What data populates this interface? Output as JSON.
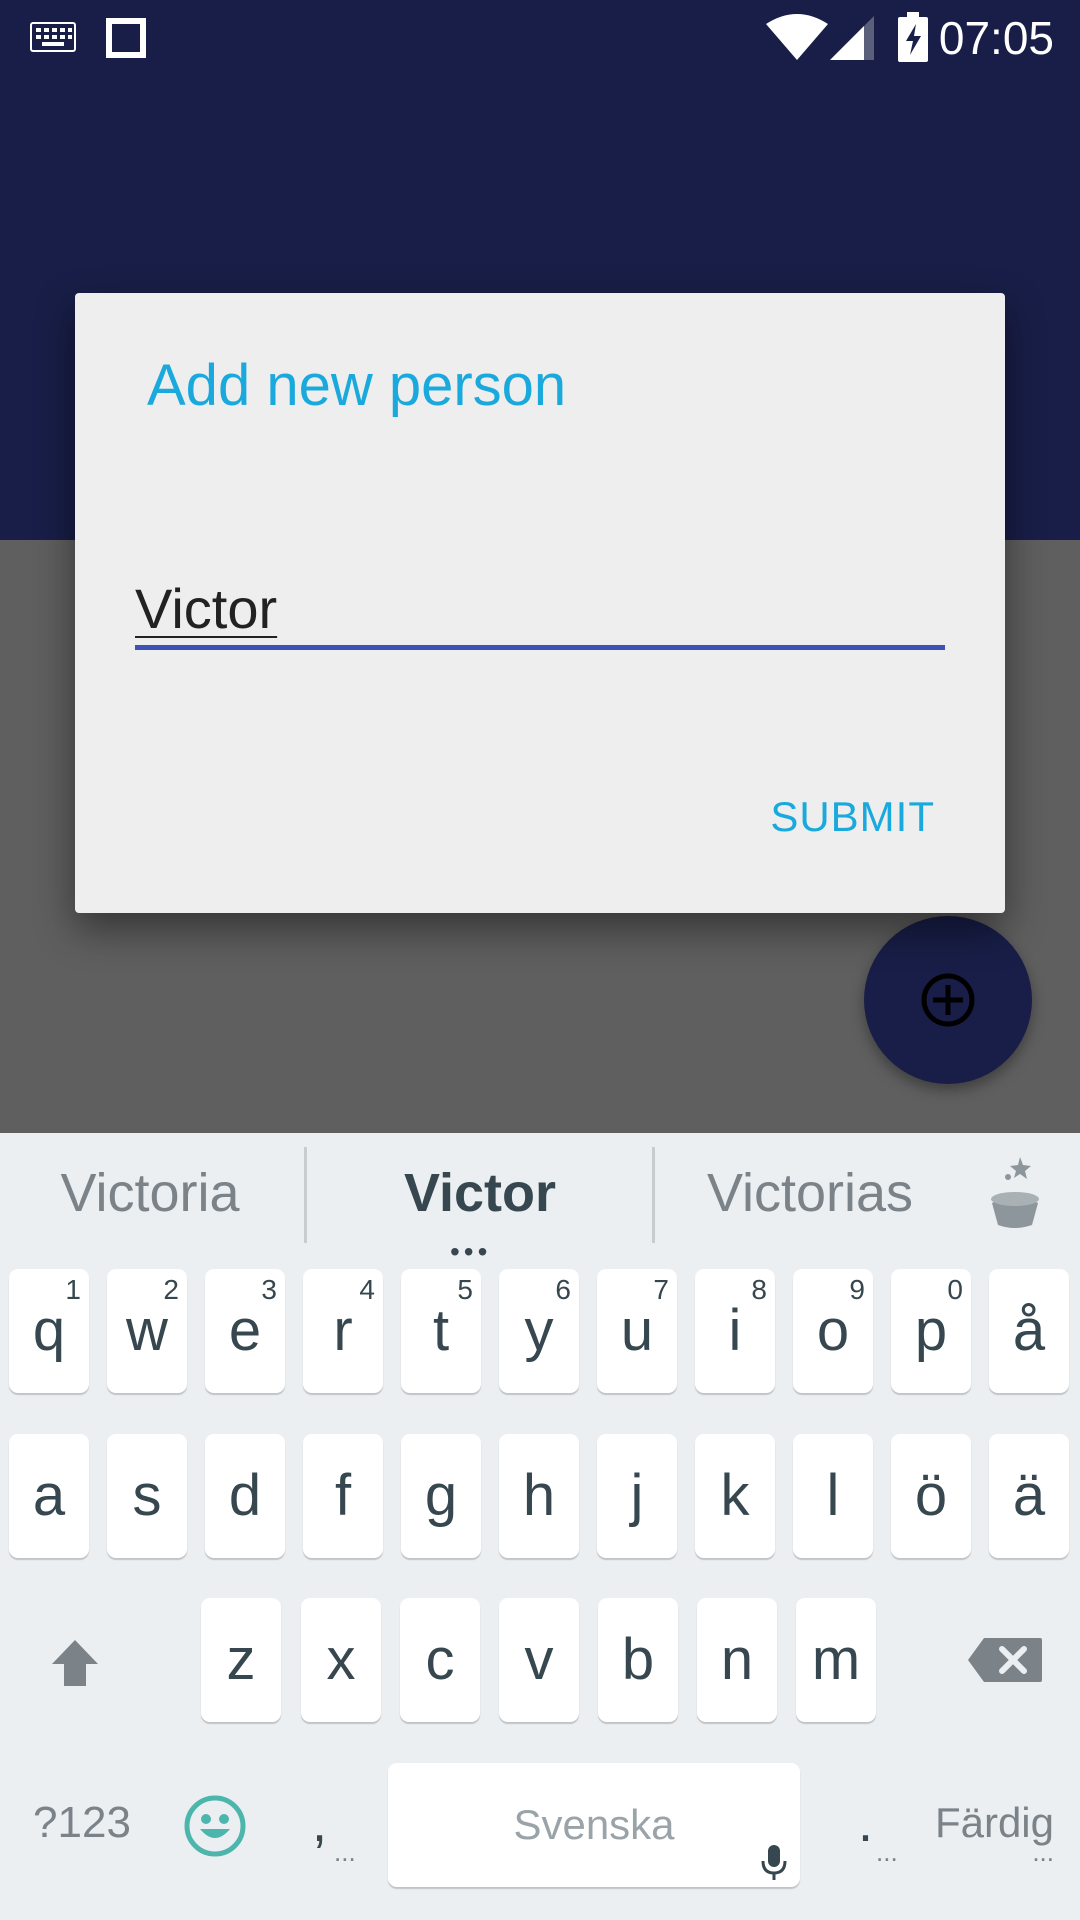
{
  "status_bar": {
    "time": "07:05",
    "icons": [
      "keyboard-icon",
      "square-notification-icon",
      "wifi-icon",
      "signal-icon",
      "battery-charging-icon"
    ]
  },
  "dialog": {
    "title": "Add new person",
    "input_value": "Victor",
    "submit_label": "SUBMIT"
  },
  "fab": {
    "icon": "add-circle-icon"
  },
  "keyboard": {
    "suggestions": [
      "Victoria",
      "Victor",
      "Victorias"
    ],
    "suggestions_more": "•••",
    "row1": [
      {
        "key": "q",
        "hint": "1"
      },
      {
        "key": "w",
        "hint": "2"
      },
      {
        "key": "e",
        "hint": "3"
      },
      {
        "key": "r",
        "hint": "4"
      },
      {
        "key": "t",
        "hint": "5"
      },
      {
        "key": "y",
        "hint": "6"
      },
      {
        "key": "u",
        "hint": "7"
      },
      {
        "key": "i",
        "hint": "8"
      },
      {
        "key": "o",
        "hint": "9"
      },
      {
        "key": "p",
        "hint": "0"
      },
      {
        "key": "å",
        "hint": ""
      }
    ],
    "row2": [
      "a",
      "s",
      "d",
      "f",
      "g",
      "h",
      "j",
      "k",
      "l",
      "ö",
      "ä"
    ],
    "row3": [
      "z",
      "x",
      "c",
      "v",
      "b",
      "n",
      "m"
    ],
    "symbols_label": "?123",
    "comma_label": ",",
    "comma_more": "...",
    "space_label": "Svenska",
    "period_label": ".",
    "period_more": "...",
    "done_label": "Färdig",
    "done_more": "...",
    "colors": {
      "background": "#ebeff2",
      "key": "#ffffff",
      "text": "#37474f",
      "emoji": "#4db6ac"
    }
  },
  "colors": {
    "app_bar": "#181e47",
    "dim_overlay": "#5f5f5f",
    "dialog_bg": "#eeeeee",
    "accent": "#1aa9dc",
    "input_underline": "#3f51b5"
  }
}
